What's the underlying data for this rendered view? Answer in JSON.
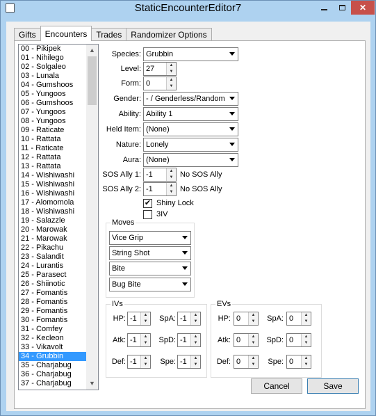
{
  "window": {
    "title": "StaticEncounterEditor7"
  },
  "tabs": [
    {
      "label": "Gifts"
    },
    {
      "label": "Encounters"
    },
    {
      "label": "Trades"
    },
    {
      "label": "Randomizer Options"
    }
  ],
  "encounters": [
    "00 - Pikipek",
    "01 - Nihilego",
    "02 - Solgaleo",
    "03 - Lunala",
    "04 - Gumshoos",
    "05 - Yungoos",
    "06 - Gumshoos",
    "07 - Yungoos",
    "08 - Yungoos",
    "09 - Raticate",
    "10 - Rattata",
    "11 - Raticate",
    "12 - Rattata",
    "13 - Rattata",
    "14 - Wishiwashi",
    "15 - Wishiwashi",
    "16 - Wishiwashi",
    "17 - Alomomola",
    "18 - Wishiwashi",
    "19 - Salazzle",
    "20 - Marowak",
    "21 - Marowak",
    "22 - Pikachu",
    "23 - Salandit",
    "24 - Lurantis",
    "25 - Parasect",
    "26 - Shiinotic",
    "27 - Fomantis",
    "28 - Fomantis",
    "29 - Fomantis",
    "30 - Fomantis",
    "31 - Comfey",
    "32 - Kecleon",
    "33 - Vikavolt",
    "34 - Grubbin",
    "35 - Charjabug",
    "36 - Charjabug",
    "37 - Charjabug"
  ],
  "selected_index": 34,
  "form": {
    "species_label": "Species:",
    "species_value": "Grubbin",
    "level_label": "Level:",
    "level_value": "27",
    "form_label": "Form:",
    "form_value": "0",
    "gender_label": "Gender:",
    "gender_value": "- / Genderless/Random",
    "ability_label": "Ability:",
    "ability_value": "Ability 1",
    "helditem_label": "Held Item:",
    "helditem_value": "(None)",
    "nature_label": "Nature:",
    "nature_value": "Lonely",
    "aura_label": "Aura:",
    "aura_value": "(None)",
    "sos1_label": "SOS Ally 1:",
    "sos1_value": "-1",
    "sos1_text": "No SOS Ally",
    "sos2_label": "SOS Ally 2:",
    "sos2_value": "-1",
    "sos2_text": "No SOS Ally",
    "shiny_label": "Shiny Lock",
    "shiny_checked": true,
    "iv3_label": "3IV",
    "iv3_checked": false
  },
  "moves": {
    "title": "Moves",
    "list": [
      "Vice Grip",
      "String Shot",
      "Bite",
      "Bug Bite"
    ]
  },
  "ivs": {
    "title": "IVs",
    "hp_label": "HP:",
    "hp": "-1",
    "atk_label": "Atk:",
    "atk": "-1",
    "def_label": "Def:",
    "def": "-1",
    "spa_label": "SpA:",
    "spa": "-1",
    "spd_label": "SpD:",
    "spd": "-1",
    "spe_label": "Spe:",
    "spe": "-1"
  },
  "evs": {
    "title": "EVs",
    "hp_label": "HP:",
    "hp": "0",
    "atk_label": "Atk:",
    "atk": "0",
    "def_label": "Def:",
    "def": "0",
    "spa_label": "SpA:",
    "spa": "0",
    "spd_label": "SpD:",
    "spd": "0",
    "spe_label": "Spe:",
    "spe": "0"
  },
  "buttons": {
    "cancel": "Cancel",
    "save": "Save"
  },
  "icons": {
    "check": "✔",
    "up": "▲",
    "down": "▼",
    "close": "✕"
  },
  "colors": {
    "selection": "#3399ff",
    "close": "#c7504a"
  }
}
